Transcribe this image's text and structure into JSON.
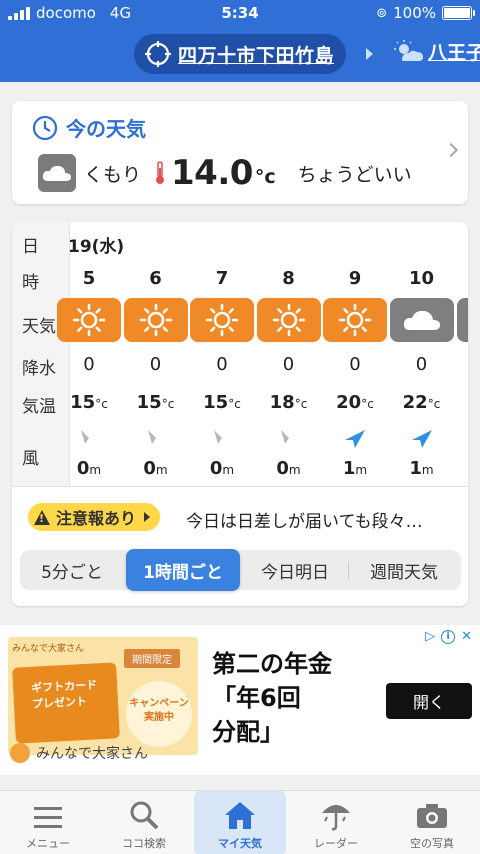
{
  "status": {
    "carrier": "docomo",
    "network": "4G",
    "time": "5:34",
    "battery": "100%"
  },
  "header": {
    "location": "四万十市下田竹島",
    "next_location": "八王子"
  },
  "now": {
    "title": "今の天気",
    "condition": "くもり",
    "temperature": "14.0",
    "unit": "°c",
    "feeling": "ちょうどいい"
  },
  "hourly": {
    "labels": {
      "day": "日",
      "hour": "時",
      "weather": "天気",
      "rain": "降水",
      "temp": "気温",
      "wind": "風"
    },
    "date": "19(水)",
    "hours": [
      "5",
      "6",
      "7",
      "8",
      "9",
      "10"
    ],
    "weather": [
      "sunny-icon",
      "sunny-icon",
      "sunny-icon",
      "sunny-icon",
      "sunny-icon",
      "cloudy-icon"
    ],
    "rain": [
      "0",
      "0",
      "0",
      "0",
      "0",
      "0"
    ],
    "temps": [
      "15",
      "15",
      "15",
      "18",
      "20",
      "22"
    ],
    "temp_unit": "°c",
    "wind": [
      "0",
      "0",
      "0",
      "0",
      "1",
      "1"
    ],
    "wind_unit": "m",
    "wind_arrow_color_calm": "#b8b8b8",
    "wind_arrow_color": "#2f8fe0"
  },
  "alert": {
    "badge": "注意報あり",
    "text": "今日は日差しが届いても段々…"
  },
  "segments": {
    "items": [
      "5分ごと",
      "1時間ごと",
      "今日明日",
      "週間天気"
    ],
    "active_index": 1
  },
  "ad": {
    "info": "▷",
    "image_logo": "みんなで大家さん",
    "image_badge": "期間限定",
    "image_card_line1": "ギフトカード",
    "image_card_line2": "プレゼント",
    "image_campaign_line1": "キャンペーン",
    "image_campaign_line2": "実施中",
    "headline_line1": "第二の年金",
    "headline_line2": "「年6回",
    "headline_line3": "分配」",
    "button": "開く",
    "brand": "みんなで大家さん"
  },
  "tabs": [
    {
      "label": "メニュー",
      "icon": "menu-icon"
    },
    {
      "label": "ココ検索",
      "icon": "search-icon"
    },
    {
      "label": "マイ天気",
      "icon": "home-icon"
    },
    {
      "label": "レーダー",
      "icon": "radar-icon"
    },
    {
      "label": "空の写真",
      "icon": "camera-icon"
    }
  ],
  "colors": {
    "header": "#2f6fd6",
    "sunny": "#f08a28",
    "cloudy": "#7f7f7f",
    "accent": "#3b82e0",
    "alert": "#ffd84a"
  }
}
